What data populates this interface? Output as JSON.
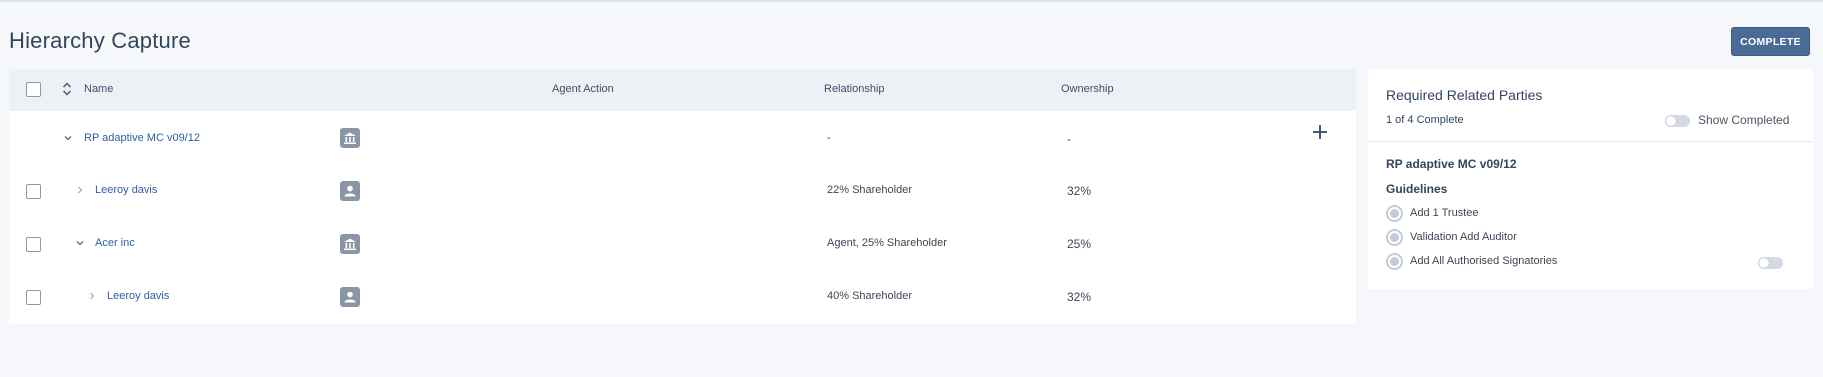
{
  "page": {
    "title": "Hierarchy Capture",
    "complete_label": "COMPLETE"
  },
  "table": {
    "columns": {
      "name": "Name",
      "agent_action": "Agent Action",
      "relationship": "Relationship",
      "ownership": "Ownership"
    },
    "rows": [
      {
        "name": "RP adaptive MC v09/12",
        "type": "entity",
        "expanded": true,
        "relationship": "-",
        "ownership": "-"
      },
      {
        "name": "Leeroy davis",
        "type": "person",
        "expanded": false,
        "relationship": "22% Shareholder",
        "ownership": "32%"
      },
      {
        "name": "Acer inc",
        "type": "entity",
        "expanded": true,
        "relationship": "Agent, 25% Shareholder",
        "ownership": "25%"
      },
      {
        "name": "Leeroy davis",
        "type": "person",
        "expanded": false,
        "relationship": "40% Shareholder",
        "ownership": "32%"
      }
    ]
  },
  "required_parties": {
    "title": "Required Related Parties",
    "progress": "1 of 4 Complete",
    "show_completed_label": "Show Completed",
    "show_completed_on": false,
    "entity_name": "RP adaptive MC v09/12",
    "guidelines_label": "Guidelines",
    "guidelines": [
      {
        "label": "Add 1 Trustee"
      },
      {
        "label": "Validation Add Auditor"
      },
      {
        "label": "Add All Authorised Signatories",
        "has_toggle": true,
        "toggle_on": false
      }
    ]
  },
  "colors": {
    "accent": "#4a6b96",
    "link": "#2f5f9e",
    "icon_bg": "#8a96a6"
  },
  "icons": {
    "entity": "bank-building-icon",
    "person": "person-card-icon",
    "sort": "sort-icon",
    "add": "plus-icon"
  }
}
